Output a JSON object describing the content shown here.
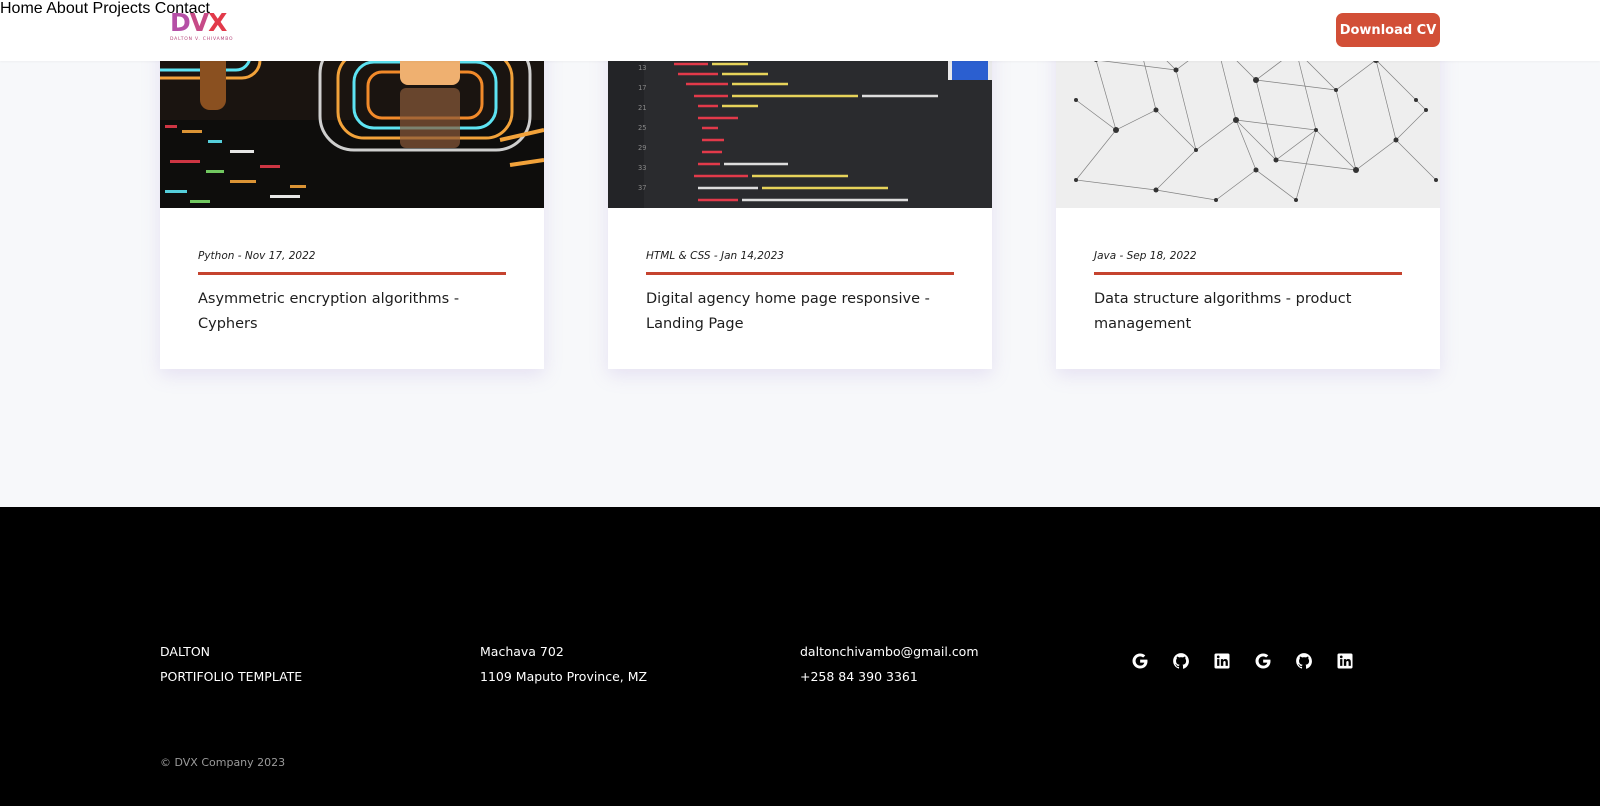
{
  "header": {
    "logo_text": {
      "d": "D",
      "v": "V",
      "x": "X"
    },
    "logo_sub": "DALTON V. CHIVAMBO",
    "nav": [
      "Home",
      "About",
      "Projects",
      "Contact"
    ],
    "cv_button": "Download CV",
    "colors": {
      "nav": "#4b2fc4",
      "button": "#d24f37"
    }
  },
  "cards": [
    {
      "meta": "Python - Nov 17, 2022",
      "title": "Asymmetric encryption algorithms - Cyphers",
      "image": "padlock-circuit-image"
    },
    {
      "meta": "HTML & CSS - Jan 14,2023",
      "title": "Digital agency home page responsive - Landing Page",
      "image": "code-editor-image"
    },
    {
      "meta": "Java - Sep 18, 2022",
      "title": "Data structure algorithms - product management",
      "image": "network-graph-image"
    }
  ],
  "footer": {
    "name_line1": "DALTON",
    "name_line2": "PORTIFOLIO TEMPLATE",
    "address_line1": "Machava 702",
    "address_line2": "1109 Maputo Province, MZ",
    "email": "daltonchivambo@gmail.com",
    "phone": "+258 84 390 3361",
    "socials": [
      "google-icon",
      "github-icon",
      "linkedin-icon",
      "google-icon",
      "github-icon",
      "linkedin-icon"
    ],
    "copyright": "© DVX Company 2023"
  },
  "accent_color": "#c5432f"
}
